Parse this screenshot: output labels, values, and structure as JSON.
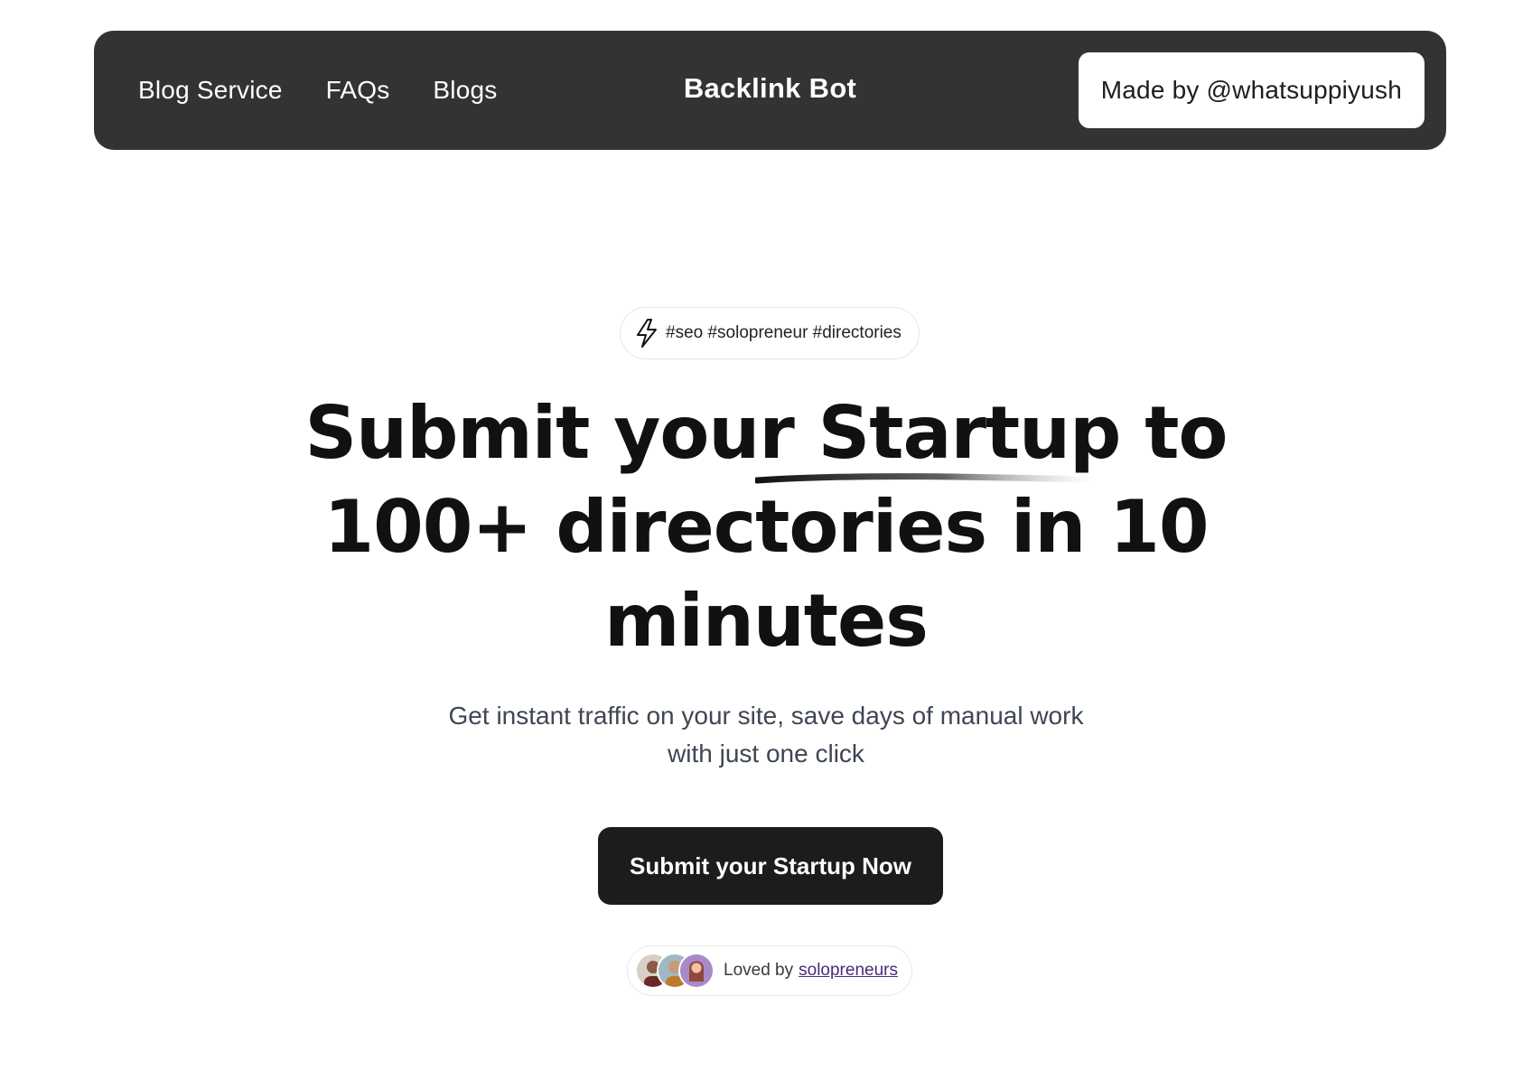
{
  "nav": {
    "links": [
      "Blog Service",
      "FAQs",
      "Blogs"
    ],
    "brand": "Backlink Bot",
    "made_by": "Made by @whatsuppiyush"
  },
  "hero": {
    "tags_icon": "lightning-bolt-icon",
    "tags": "#seo #solopreneur #directories",
    "headline": "Submit your Startup to 100+ directories in 10 minutes",
    "subtitle_line1": "Get instant traffic on your site, save days of manual work",
    "subtitle_line2": "with just one click",
    "cta_label": "Submit your Startup Now",
    "loved_by_prefix": "Loved by",
    "loved_by_link": "solopreneurs"
  },
  "colors": {
    "nav_background": "#333333",
    "cta_background": "#1c1c1c",
    "subtitle_text": "#3f4654",
    "link_accent": "#4c2a7a"
  }
}
